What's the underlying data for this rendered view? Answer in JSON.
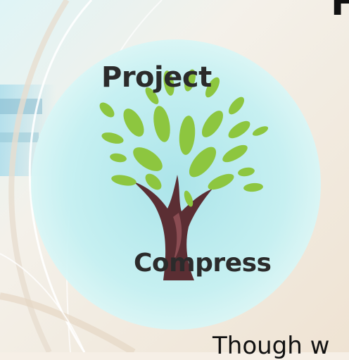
{
  "slide": {
    "heading_fragment": "F",
    "body_fragment": "Though w"
  },
  "logo": {
    "line1": "Project",
    "line2": "Compress",
    "leaf_color": "#8dc63f",
    "trunk_color": "#5b2e33",
    "circle_color": "#bfeff1"
  }
}
